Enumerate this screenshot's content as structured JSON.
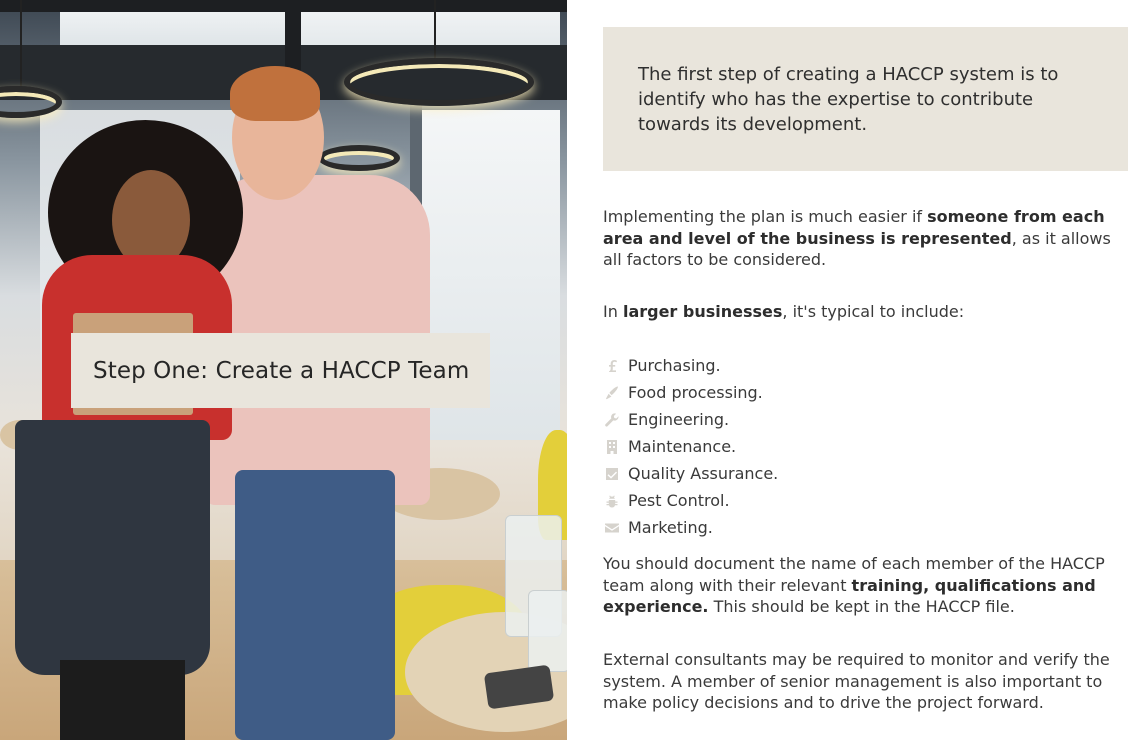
{
  "title_card": {
    "label": "Step One: Create a HACCP Team"
  },
  "intro": {
    "text": "The first step of creating a HACCP system is to identify who has the expertise to contribute towards its development."
  },
  "paragraph1": {
    "pre": "Implementing the plan is much easier if ",
    "bold": "someone from each area and level of the business is represented",
    "post": ", as it allows all factors to be considered."
  },
  "paragraph2": {
    "pre": "In ",
    "bold": "larger businesses",
    "post": ", it's typical to include:"
  },
  "list": [
    {
      "icon": "pound-icon",
      "label": "Purchasing."
    },
    {
      "icon": "knife-icon",
      "label": "Food processing."
    },
    {
      "icon": "wrench-icon",
      "label": "Engineering."
    },
    {
      "icon": "building-icon",
      "label": "Maintenance."
    },
    {
      "icon": "checkbox-icon",
      "label": "Quality Assurance."
    },
    {
      "icon": "bug-icon",
      "label": "Pest Control."
    },
    {
      "icon": "envelope-icon",
      "label": "Marketing."
    }
  ],
  "paragraph3": {
    "pre": "You should document the name of each member of the HACCP team along with their relevant ",
    "bold": "training, qualifications and experience.",
    "post": " This should be kept in the HACCP file."
  },
  "paragraph4": {
    "text": "External consultants may be required to monitor and verify the system. A member of senior management is also important to make policy decisions and to drive the project forward."
  },
  "colors": {
    "card_bg": "#e9e5dc",
    "icon": "#d6d3cd",
    "text": "#3a3a3a"
  }
}
